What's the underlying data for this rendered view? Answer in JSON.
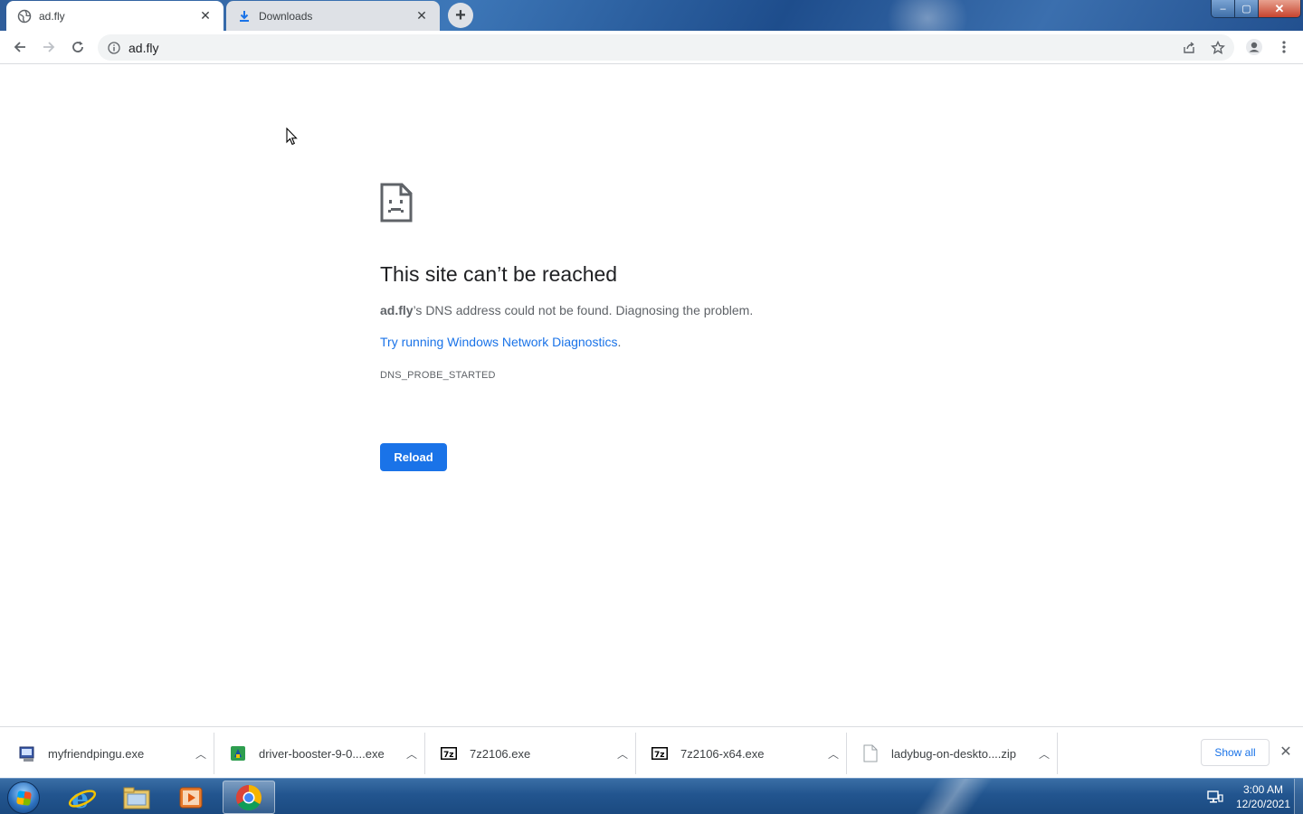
{
  "tabs": [
    {
      "title": "ad.fly",
      "icon": "globe-icon",
      "active": true
    },
    {
      "title": "Downloads",
      "icon": "download-icon",
      "active": false
    }
  ],
  "window_controls": {
    "minimize": "–",
    "maximize": "▢",
    "close": "✕"
  },
  "toolbar": {
    "url": "ad.fly"
  },
  "error_page": {
    "title": "This site can’t be reached",
    "host": "ad.fly",
    "desc_rest": "’s DNS address could not be found. Diagnosing the problem.",
    "link_text": "Try running Windows Network Diagnostics",
    "link_suffix": ".",
    "error_code": "DNS_PROBE_STARTED",
    "reload_label": "Reload"
  },
  "downloads": {
    "items": [
      {
        "name": "myfriendpingu.exe",
        "icon": "exe-installer-icon"
      },
      {
        "name": "driver-booster-9-0....exe",
        "icon": "driver-booster-icon"
      },
      {
        "name": "7z2106.exe",
        "icon": "7zip-icon"
      },
      {
        "name": "7z2106-x64.exe",
        "icon": "7zip-icon"
      },
      {
        "name": "ladybug-on-deskto....zip",
        "icon": "file-icon"
      }
    ],
    "show_all_label": "Show all"
  },
  "taskbar": {
    "apps": [
      "internet-explorer",
      "file-explorer",
      "media-player",
      "chrome"
    ],
    "time": "3:00 AM",
    "date": "12/20/2021"
  },
  "colors": {
    "accent": "#1a73e8",
    "link": "#1a73e8",
    "taskbar": "#22558f"
  }
}
